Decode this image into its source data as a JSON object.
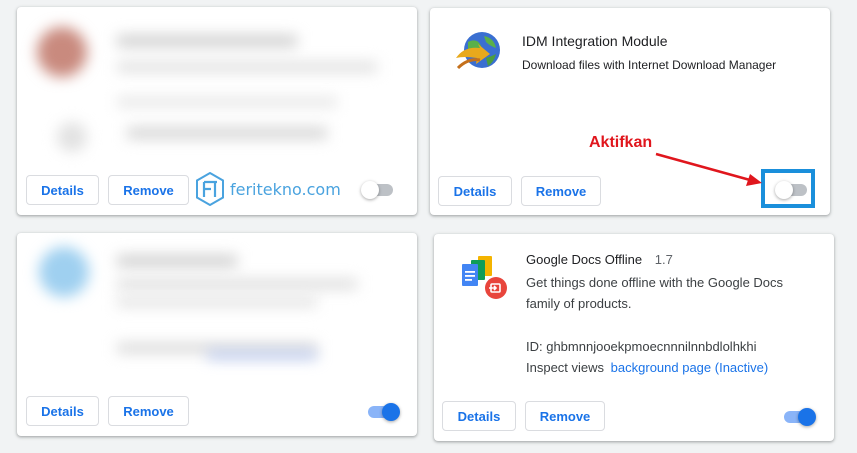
{
  "cards": {
    "blurred_top": {
      "details_label": "Details",
      "remove_label": "Remove"
    },
    "idm": {
      "name": "IDM Integration Module",
      "description": "Download files with Internet Download Manager",
      "details_label": "Details",
      "remove_label": "Remove",
      "enabled": false
    },
    "blurred_bottom": {
      "details_label": "Details",
      "remove_label": "Remove",
      "enabled": true
    },
    "gdocs": {
      "name": "Google Docs Offline",
      "version": "1.7",
      "description": "Get things done offline with the Google Docs family of products.",
      "id_line": "ID: ghbmnnjooekpmoecnnnilnnbdlolhkhi",
      "inspect_label": "Inspect views",
      "inspect_link": "background page (Inactive)",
      "details_label": "Details",
      "remove_label": "Remove",
      "enabled": true
    }
  },
  "annotation": {
    "label": "Aktifkan",
    "color": "#e0161d",
    "highlight_color": "#1a8fdb"
  },
  "watermark": {
    "text": "feritekno.com",
    "logo_letters": "FT",
    "color": "#4aa3df"
  },
  "colors": {
    "accent": "#1a73e8",
    "background": "#f1f3f4"
  }
}
